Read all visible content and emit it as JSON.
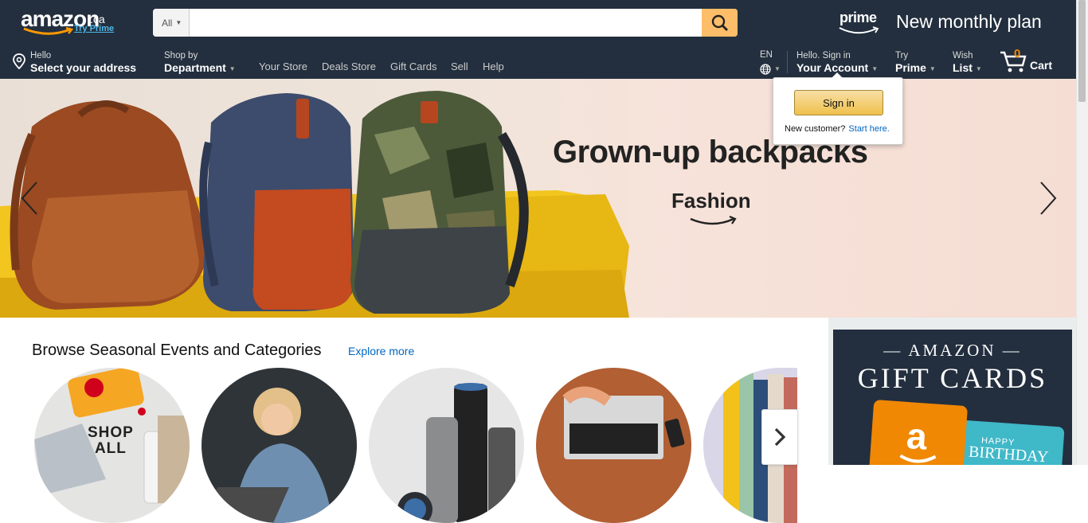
{
  "header": {
    "logo_word": "amazon",
    "logo_domain": ".ca",
    "logo_try_prime": "Try Prime",
    "search_category": "All",
    "search_placeholder": "",
    "prime_word": "prime",
    "promo": "New monthly plan"
  },
  "nav": {
    "address_line1": "Hello",
    "address_line2": "Select your address",
    "department_line1": "Shop by",
    "department_line2": "Department",
    "links": [
      "Your Store",
      "Deals Store",
      "Gift Cards",
      "Sell",
      "Help"
    ],
    "language": "EN",
    "account_line1": "Hello. Sign in",
    "account_line2": "Your Account",
    "prime_line1": "Try",
    "prime_line2": "Prime",
    "wishlist_line1": "Wish",
    "wishlist_line2": "List",
    "cart_count": "0",
    "cart_label": "Cart"
  },
  "signin_popover": {
    "button": "Sign in",
    "new_customer": "New customer?",
    "start_here": "Start here."
  },
  "hero": {
    "title": "Grown-up backpacks",
    "brand": "Fashion"
  },
  "browse": {
    "title": "Browse Seasonal Events and Categories",
    "explore": "Explore more",
    "shop_all_line1": "SHOP",
    "shop_all_line2": "ALL"
  },
  "gift_card_panel": {
    "line1": "— AMAZON —",
    "line2": "GIFT CARDS",
    "card_happy": "HAPPY",
    "card_birthday": "BIRTHDAY"
  },
  "colors": {
    "nav_bg": "#232f3e",
    "search_button": "#febd69",
    "link_blue": "#0066c0",
    "cart_orange": "#f08804"
  }
}
